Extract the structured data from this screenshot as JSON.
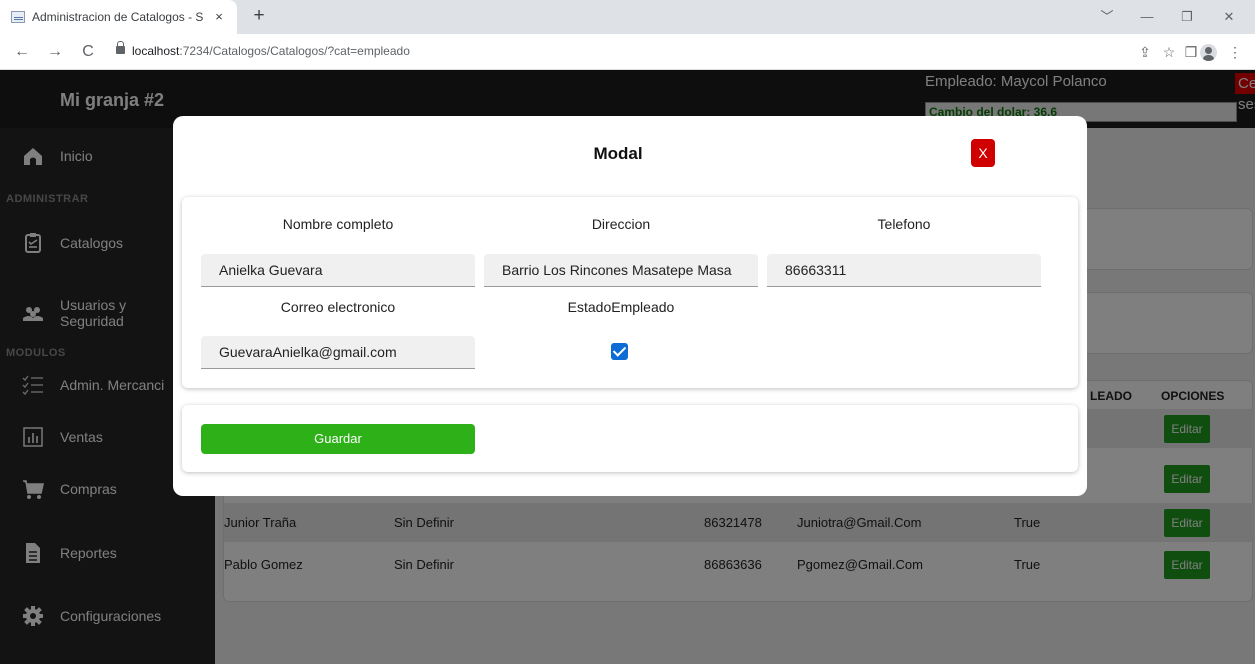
{
  "browser": {
    "tab_title": "Administracion de Catalogos - S",
    "tab_close": "×",
    "new_tab": "+",
    "url_host": "localhost",
    "url_path": ":7234/Catalogos/Catalogos/?cat=empleado",
    "back": "←",
    "forward": "→",
    "reload": "C",
    "minimize": "﹀",
    "min2": "—",
    "restore": "❐",
    "close": "✕",
    "share": "⇪",
    "star": "☆",
    "sidepanel": "❒",
    "menu": "⋮"
  },
  "sidebar": {
    "brand": "Mi granja #2",
    "section_admin": "ADMINISTRAR",
    "section_modules": "MODULOS",
    "items": [
      {
        "label": "Inicio",
        "icon": "home-icon"
      },
      {
        "label": "Catalogos",
        "icon": "clipboard-icon"
      },
      {
        "label": "Usuarios y Seguridad",
        "icon": "users-icon"
      },
      {
        "label": "Admin. Mercanci",
        "icon": "checklist-icon"
      },
      {
        "label": "Ventas",
        "icon": "bar-chart-icon"
      },
      {
        "label": "Compras",
        "icon": "cart-icon"
      },
      {
        "label": "Reportes",
        "icon": "document-icon"
      },
      {
        "label": "Configuraciones",
        "icon": "gear-icon"
      }
    ]
  },
  "header": {
    "employee": "Empleado: Maycol Polanco",
    "logout": "Cerrar sesion",
    "dollar": "Cambio del dolar: 36.6"
  },
  "table": {
    "headers": {
      "estado": "LEADO",
      "opciones": "OPCIONES"
    },
    "rows": [
      {
        "nombre": "Junior Traña",
        "direccion": "Sin Definir",
        "telefono": "86321478",
        "correo": "Juniotra@Gmail.Com",
        "estado": "True",
        "action": "Editar"
      },
      {
        "nombre": "Pablo Gomez",
        "direccion": "Sin Definir",
        "telefono": "86863636",
        "correo": "Pgomez@Gmail.Com",
        "estado": "True",
        "action": "Editar"
      }
    ],
    "hidden_row_action": "Editar"
  },
  "modal": {
    "title": "Modal",
    "close": "X",
    "fields": {
      "nombre_label": "Nombre completo",
      "nombre_value": "Anielka Guevara",
      "direccion_label": "Direccion",
      "direccion_value": "Barrio Los Rincones Masatepe Masa",
      "telefono_label": "Telefono",
      "telefono_value": "86663311",
      "correo_label": "Correo electronico",
      "correo_value": "GuevaraAnielka@gmail.com",
      "estado_label": "EstadoEmpleado",
      "estado_checked": true
    },
    "save": "Guardar"
  },
  "colors": {
    "sidebar": "#272727",
    "save": "#2db018",
    "close": "#d10000",
    "logout": "#e60000",
    "checkbox": "#0b6cd6"
  }
}
